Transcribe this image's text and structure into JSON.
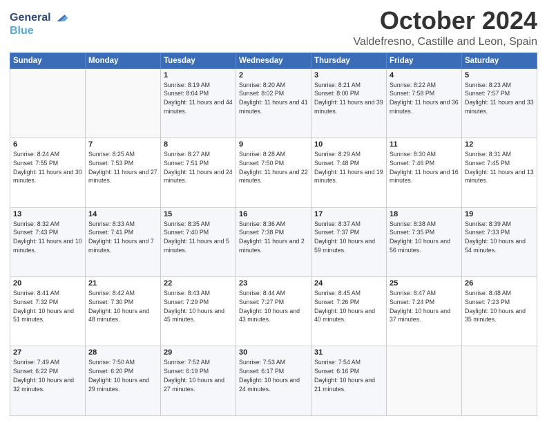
{
  "logo": {
    "line1": "General",
    "line2": "Blue"
  },
  "title": "October 2024",
  "subtitle": "Valdefresno, Castille and Leon, Spain",
  "weekdays": [
    "Sunday",
    "Monday",
    "Tuesday",
    "Wednesday",
    "Thursday",
    "Friday",
    "Saturday"
  ],
  "weeks": [
    [
      {
        "day": "",
        "info": ""
      },
      {
        "day": "",
        "info": ""
      },
      {
        "day": "1",
        "info": "Sunrise: 8:19 AM\nSunset: 8:04 PM\nDaylight: 11 hours and 44 minutes."
      },
      {
        "day": "2",
        "info": "Sunrise: 8:20 AM\nSunset: 8:02 PM\nDaylight: 11 hours and 41 minutes."
      },
      {
        "day": "3",
        "info": "Sunrise: 8:21 AM\nSunset: 8:00 PM\nDaylight: 11 hours and 39 minutes."
      },
      {
        "day": "4",
        "info": "Sunrise: 8:22 AM\nSunset: 7:58 PM\nDaylight: 11 hours and 36 minutes."
      },
      {
        "day": "5",
        "info": "Sunrise: 8:23 AM\nSunset: 7:57 PM\nDaylight: 11 hours and 33 minutes."
      }
    ],
    [
      {
        "day": "6",
        "info": "Sunrise: 8:24 AM\nSunset: 7:55 PM\nDaylight: 11 hours and 30 minutes."
      },
      {
        "day": "7",
        "info": "Sunrise: 8:25 AM\nSunset: 7:53 PM\nDaylight: 11 hours and 27 minutes."
      },
      {
        "day": "8",
        "info": "Sunrise: 8:27 AM\nSunset: 7:51 PM\nDaylight: 11 hours and 24 minutes."
      },
      {
        "day": "9",
        "info": "Sunrise: 8:28 AM\nSunset: 7:50 PM\nDaylight: 11 hours and 22 minutes."
      },
      {
        "day": "10",
        "info": "Sunrise: 8:29 AM\nSunset: 7:48 PM\nDaylight: 11 hours and 19 minutes."
      },
      {
        "day": "11",
        "info": "Sunrise: 8:30 AM\nSunset: 7:46 PM\nDaylight: 11 hours and 16 minutes."
      },
      {
        "day": "12",
        "info": "Sunrise: 8:31 AM\nSunset: 7:45 PM\nDaylight: 11 hours and 13 minutes."
      }
    ],
    [
      {
        "day": "13",
        "info": "Sunrise: 8:32 AM\nSunset: 7:43 PM\nDaylight: 11 hours and 10 minutes."
      },
      {
        "day": "14",
        "info": "Sunrise: 8:33 AM\nSunset: 7:41 PM\nDaylight: 11 hours and 7 minutes."
      },
      {
        "day": "15",
        "info": "Sunrise: 8:35 AM\nSunset: 7:40 PM\nDaylight: 11 hours and 5 minutes."
      },
      {
        "day": "16",
        "info": "Sunrise: 8:36 AM\nSunset: 7:38 PM\nDaylight: 11 hours and 2 minutes."
      },
      {
        "day": "17",
        "info": "Sunrise: 8:37 AM\nSunset: 7:37 PM\nDaylight: 10 hours and 59 minutes."
      },
      {
        "day": "18",
        "info": "Sunrise: 8:38 AM\nSunset: 7:35 PM\nDaylight: 10 hours and 56 minutes."
      },
      {
        "day": "19",
        "info": "Sunrise: 8:39 AM\nSunset: 7:33 PM\nDaylight: 10 hours and 54 minutes."
      }
    ],
    [
      {
        "day": "20",
        "info": "Sunrise: 8:41 AM\nSunset: 7:32 PM\nDaylight: 10 hours and 51 minutes."
      },
      {
        "day": "21",
        "info": "Sunrise: 8:42 AM\nSunset: 7:30 PM\nDaylight: 10 hours and 48 minutes."
      },
      {
        "day": "22",
        "info": "Sunrise: 8:43 AM\nSunset: 7:29 PM\nDaylight: 10 hours and 45 minutes."
      },
      {
        "day": "23",
        "info": "Sunrise: 8:44 AM\nSunset: 7:27 PM\nDaylight: 10 hours and 43 minutes."
      },
      {
        "day": "24",
        "info": "Sunrise: 8:45 AM\nSunset: 7:26 PM\nDaylight: 10 hours and 40 minutes."
      },
      {
        "day": "25",
        "info": "Sunrise: 8:47 AM\nSunset: 7:24 PM\nDaylight: 10 hours and 37 minutes."
      },
      {
        "day": "26",
        "info": "Sunrise: 8:48 AM\nSunset: 7:23 PM\nDaylight: 10 hours and 35 minutes."
      }
    ],
    [
      {
        "day": "27",
        "info": "Sunrise: 7:49 AM\nSunset: 6:22 PM\nDaylight: 10 hours and 32 minutes."
      },
      {
        "day": "28",
        "info": "Sunrise: 7:50 AM\nSunset: 6:20 PM\nDaylight: 10 hours and 29 minutes."
      },
      {
        "day": "29",
        "info": "Sunrise: 7:52 AM\nSunset: 6:19 PM\nDaylight: 10 hours and 27 minutes."
      },
      {
        "day": "30",
        "info": "Sunrise: 7:53 AM\nSunset: 6:17 PM\nDaylight: 10 hours and 24 minutes."
      },
      {
        "day": "31",
        "info": "Sunrise: 7:54 AM\nSunset: 6:16 PM\nDaylight: 10 hours and 21 minutes."
      },
      {
        "day": "",
        "info": ""
      },
      {
        "day": "",
        "info": ""
      }
    ]
  ]
}
